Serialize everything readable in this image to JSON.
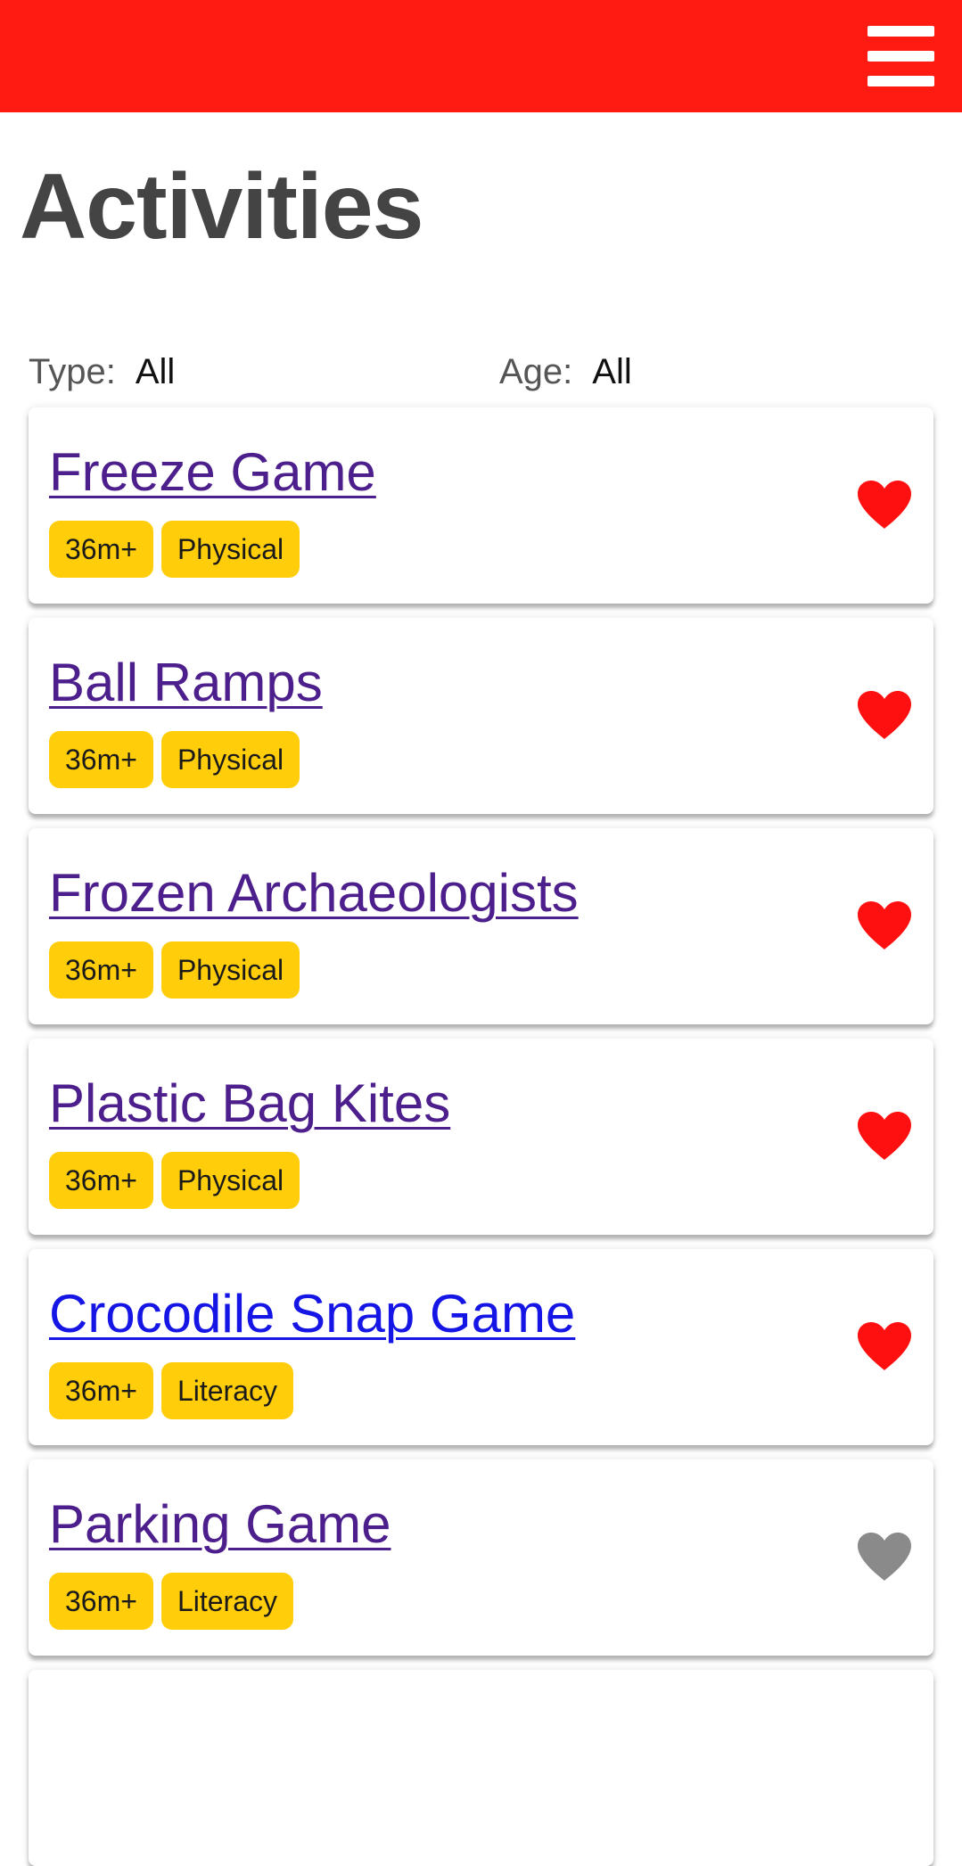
{
  "header": {
    "menu_icon": "hamburger-menu-icon",
    "bar_color": "#ff1a12"
  },
  "page": {
    "title": "Activities"
  },
  "filters": {
    "type": {
      "label": "Type:",
      "value": "All"
    },
    "age": {
      "label": "Age:",
      "value": "All"
    }
  },
  "activities": [
    {
      "title": "Freeze Game",
      "tags": [
        "36m+",
        "Physical"
      ],
      "favorited": true,
      "visited": true
    },
    {
      "title": "Ball Ramps",
      "tags": [
        "36m+",
        "Physical"
      ],
      "favorited": true,
      "visited": true
    },
    {
      "title": "Frozen Archaeologists",
      "tags": [
        "36m+",
        "Physical"
      ],
      "favorited": true,
      "visited": true
    },
    {
      "title": "Plastic Bag Kites",
      "tags": [
        "36m+",
        "Physical"
      ],
      "favorited": true,
      "visited": true
    },
    {
      "title": "Crocodile Snap Game",
      "tags": [
        "36m+",
        "Literacy"
      ],
      "favorited": true,
      "visited": false
    },
    {
      "title": "Parking Game",
      "tags": [
        "36m+",
        "Literacy"
      ],
      "favorited": false,
      "visited": true
    }
  ],
  "colors": {
    "accent": "#ff1a12",
    "tag_bg": "#ffcd0a",
    "heart_on": "#ff1010",
    "heart_off": "#8a8a8a",
    "link_visited": "#4d1f8c",
    "link_unvisited": "#1515e6"
  }
}
